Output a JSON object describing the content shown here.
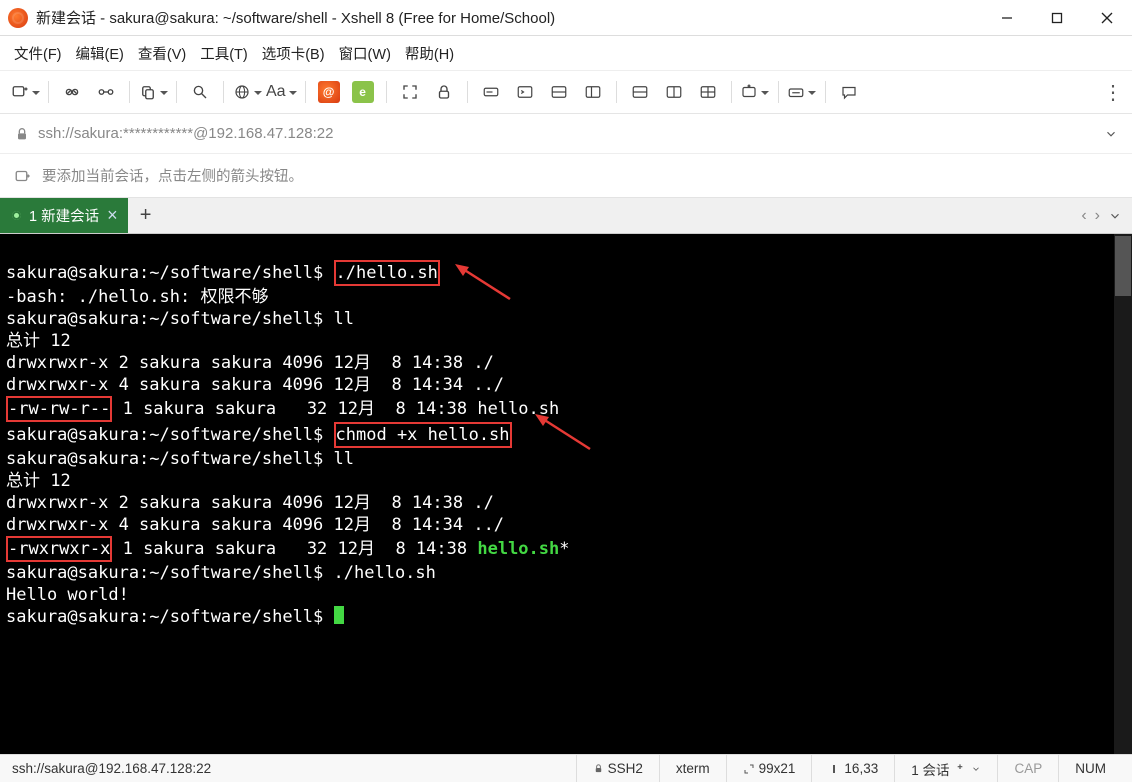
{
  "title": "新建会话 - sakura@sakura: ~/software/shell - Xshell 8 (Free for Home/School)",
  "menu": {
    "file": "文件(F)",
    "edit": "编辑(E)",
    "view": "查看(V)",
    "tools": "工具(T)",
    "tab": "选项卡(B)",
    "window": "窗口(W)",
    "help": "帮助(H)"
  },
  "toolbar": {
    "font_label": "Aa"
  },
  "address": "ssh://sakura:************@192.168.47.128:22",
  "hint": "要添加当前会话，点击左侧的箭头按钮。",
  "tab": {
    "label": "1 新建会话"
  },
  "term": {
    "prompt": "sakura@sakura:~/software/shell$",
    "cmd_hello_fail": "./hello.sh",
    "bash_error": "-bash: ./hello.sh: 权限不够",
    "cmd_ll": "ll",
    "total": "总计 12",
    "row_dot": "drwxrwxr-x 2 sakura sakura 4096 12月  8 14:38 ./",
    "row_pp": "drwxrwxr-x 4 sakura sakura 4096 12月  8 14:34 ../",
    "perm_before": "-rw-rw-r--",
    "row_before_rest": " 1 sakura sakura   32 12月  8 14:38 hello.sh",
    "cmd_chmod": "chmod +x hello.sh",
    "perm_after": "-rwxrwxr-x",
    "row_after_rest": " 1 sakura sakura   32 12月  8 14:38 ",
    "hello_exec": "hello.sh",
    "star": "*",
    "cmd_hello_ok": "./hello.sh",
    "hello_out": "Hello world!"
  },
  "status": {
    "addr": "ssh://sakura@192.168.47.128:22",
    "proto": "SSH2",
    "term": "xterm",
    "size": "99x21",
    "cursor": "16,33",
    "sessions": "1 会话",
    "cap": "CAP",
    "num": "NUM"
  }
}
